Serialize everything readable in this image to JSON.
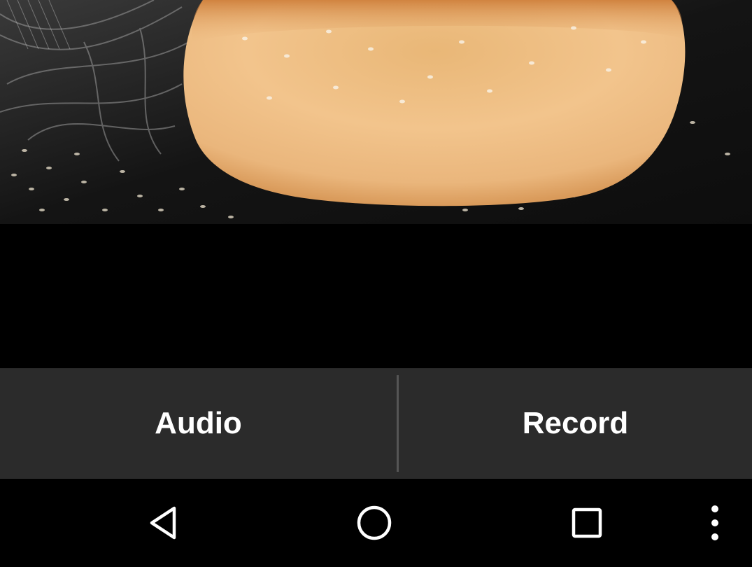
{
  "video": {
    "content": "burger-bun-video-frame"
  },
  "actions": {
    "audio_label": "Audio",
    "record_label": "Record"
  },
  "navigation": {
    "back_icon": "back-triangle-icon",
    "home_icon": "home-circle-icon",
    "recents_icon": "recents-square-icon",
    "menu_icon": "overflow-menu-icon"
  },
  "colors": {
    "action_bar_bg": "#2b2b2b",
    "divider": "#555555",
    "label": "#ffffff",
    "nav_bg": "#000000"
  }
}
